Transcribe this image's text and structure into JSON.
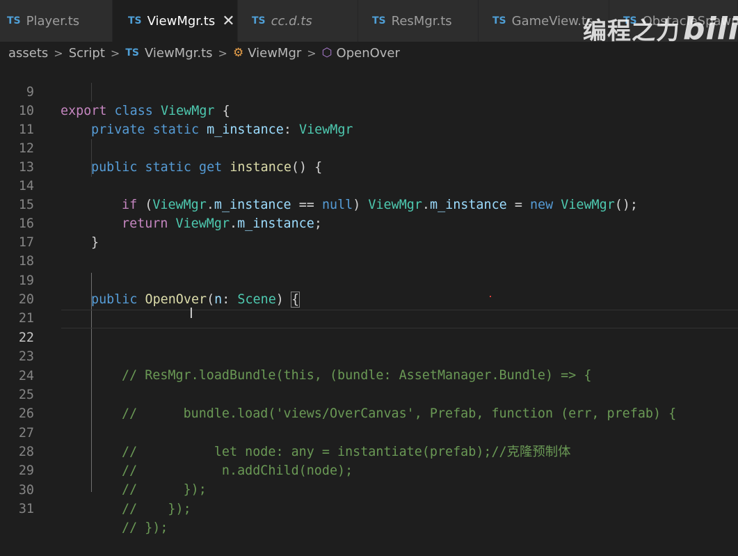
{
  "tabs": [
    {
      "name": "Player.ts",
      "italic": false,
      "active": false
    },
    {
      "name": "ViewMgr.ts",
      "italic": false,
      "active": true
    },
    {
      "name": "cc.d.ts",
      "italic": true,
      "active": false
    },
    {
      "name": "ResMgr.ts",
      "italic": false,
      "active": false
    },
    {
      "name": "GameView.ts",
      "italic": false,
      "active": false
    },
    {
      "name": "ObstacleSpawner.ts",
      "italic": false,
      "active": false
    }
  ],
  "ts_badge": "TS",
  "close_glyph": "✕",
  "watermark": {
    "text": "编程之力",
    "brand": "bili"
  },
  "breadcrumb": {
    "folder1": "assets",
    "folder2": "Script",
    "file": "ViewMgr.ts",
    "class": "ViewMgr",
    "method": "OpenOver"
  },
  "editor": {
    "current_line": 22,
    "lines": [
      {
        "n": "9"
      },
      {
        "n": "10"
      },
      {
        "n": "11"
      },
      {
        "n": "12"
      },
      {
        "n": "13"
      },
      {
        "n": "14"
      },
      {
        "n": "15"
      },
      {
        "n": "16"
      },
      {
        "n": "17"
      },
      {
        "n": "18"
      },
      {
        "n": "19"
      },
      {
        "n": "20"
      },
      {
        "n": "21"
      },
      {
        "n": "22"
      },
      {
        "n": "23"
      },
      {
        "n": "24"
      },
      {
        "n": "25"
      },
      {
        "n": "26"
      },
      {
        "n": "27"
      },
      {
        "n": "28"
      },
      {
        "n": "29"
      },
      {
        "n": "30"
      },
      {
        "n": "31"
      }
    ],
    "code": {
      "l9": [
        "export",
        "class",
        "ViewMgr",
        "{"
      ],
      "l10": [
        "private",
        "static",
        "m_instance",
        ":",
        "ViewMgr"
      ],
      "l12": [
        "public",
        "static",
        "get",
        "instance",
        "() {"
      ],
      "l14": [
        "if",
        "(",
        "ViewMgr",
        ".",
        "m_instance",
        "==",
        "null",
        ")",
        "ViewMgr",
        ".",
        "m_instance",
        "=",
        "new",
        "ViewMgr",
        "();"
      ],
      "l15": [
        "return",
        "ViewMgr",
        ".",
        "m_instance",
        ";"
      ],
      "l16": [
        "}"
      ],
      "l19": [
        "public",
        "OpenOver",
        "(",
        "n",
        ":",
        "Scene",
        ")",
        "{"
      ],
      "l23": "// ResMgr.loadBundle(this, (bundle: AssetManager.Bundle) => {",
      "l25": "//      bundle.load('views/OverCanvas', Prefab, function (err, prefab) {",
      "l27": "//          let node: any = instantiate(prefab);//克隆预制体",
      "l28": "//           n.addChild(node);",
      "l29": "//      });",
      "l30": "//    });",
      "l31": "// });"
    }
  }
}
